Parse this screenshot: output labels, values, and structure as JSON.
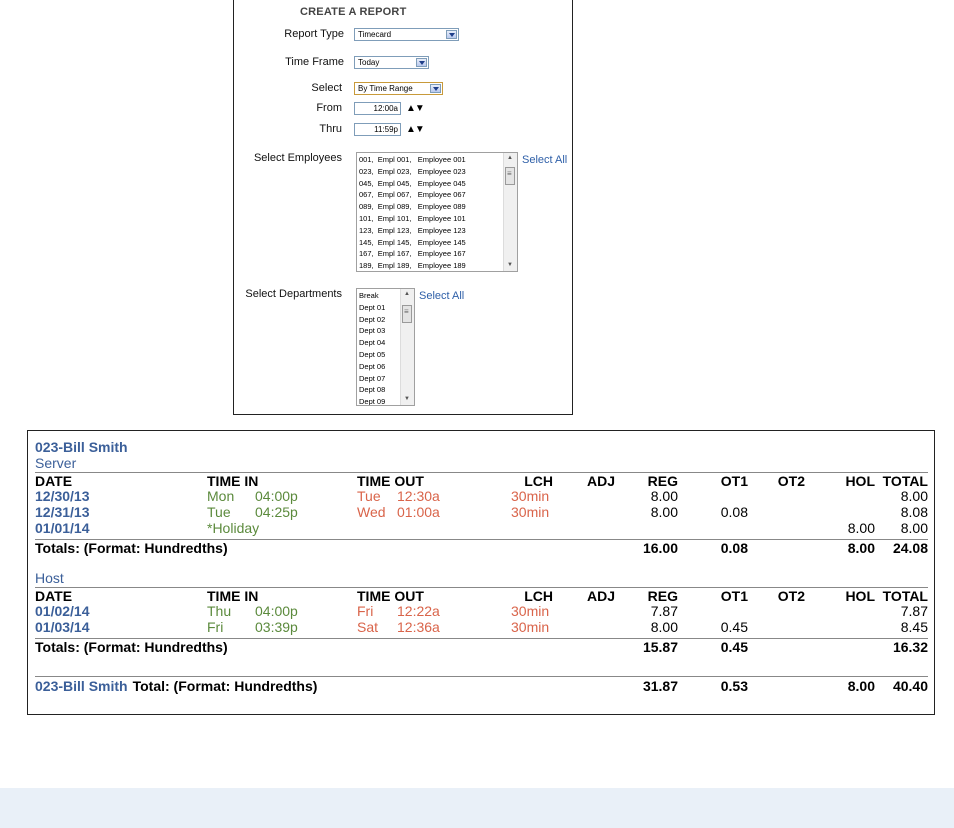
{
  "panel": {
    "title": "CREATE A REPORT",
    "report_type": {
      "label": "Report Type",
      "value": "Timecard"
    },
    "time_frame": {
      "label": "Time Frame",
      "value": "Today"
    },
    "select": {
      "label": "Select",
      "value": "By Time Range"
    },
    "from": {
      "label": "From",
      "value": "12:00a"
    },
    "thru": {
      "label": "Thru",
      "value": "11:59p"
    },
    "employees": {
      "label": "Select Employees",
      "select_all": "Select All",
      "items": [
        "001,  Empl 001,   Employee 001",
        "023,  Empl 023,   Employee 023",
        "045,  Empl 045,   Employee 045",
        "067,  Empl 067,   Employee 067",
        "089,  Empl 089,   Employee 089",
        "101,  Empl 101,   Employee 101",
        "123,  Empl 123,   Employee 123",
        "145,  Empl 145,   Employee 145",
        "167,  Empl 167,   Employee 167",
        "189,  Empl 189,   Employee 189"
      ]
    },
    "departments": {
      "label": "Select Departments",
      "select_all": "Select All",
      "items": [
        "Break",
        "Dept 01",
        "Dept 02",
        "Dept 03",
        "Dept 04",
        "Dept 05",
        "Dept 06",
        "Dept 07",
        "Dept 08",
        "Dept 09"
      ]
    }
  },
  "report": {
    "employee": "023-Bill Smith",
    "columns": [
      "DATE",
      "TIME IN",
      "TIME OUT",
      "LCH",
      "ADJ",
      "REG",
      "OT1",
      "OT2",
      "HOL",
      "TOTAL"
    ],
    "sections": [
      {
        "department": "Server",
        "rows": [
          {
            "date": "12/30/13",
            "in_day": "Mon",
            "in_time": "04:00p",
            "out_day": "Tue",
            "out_time": "12:30a",
            "lch": "30min",
            "adj": "",
            "reg": "8.00",
            "ot1": "",
            "ot2": "",
            "hol": "",
            "total": "8.00"
          },
          {
            "date": "12/31/13",
            "in_day": "Tue",
            "in_time": "04:25p",
            "out_day": "Wed",
            "out_time": "01:00a",
            "lch": "30min",
            "adj": "",
            "reg": "8.00",
            "ot1": "0.08",
            "ot2": "",
            "hol": "",
            "total": "8.08"
          },
          {
            "date": "01/01/14",
            "in_day": "*Holiday",
            "in_time": "",
            "out_day": "",
            "out_time": "",
            "lch": "",
            "adj": "",
            "reg": "",
            "ot1": "",
            "ot2": "",
            "hol": "8.00",
            "total": "8.00"
          }
        ],
        "totals": {
          "label": "Totals: (Format: Hundredths)",
          "reg": "16.00",
          "ot1": "0.08",
          "ot2": "",
          "hol": "8.00",
          "total": "24.08"
        }
      },
      {
        "department": "Host",
        "rows": [
          {
            "date": "01/02/14",
            "in_day": "Thu",
            "in_time": "04:00p",
            "out_day": "Fri",
            "out_time": "12:22a",
            "lch": "30min",
            "adj": "",
            "reg": "7.87",
            "ot1": "",
            "ot2": "",
            "hol": "",
            "total": "7.87"
          },
          {
            "date": "01/03/14",
            "in_day": "Fri",
            "in_time": "03:39p",
            "out_day": "Sat",
            "out_time": "12:36a",
            "lch": "30min",
            "adj": "",
            "reg": "8.00",
            "ot1": "0.45",
            "ot2": "",
            "hol": "",
            "total": "8.45"
          }
        ],
        "totals": {
          "label": "Totals: (Format: Hundredths)",
          "reg": "15.87",
          "ot1": "0.45",
          "ot2": "",
          "hol": "",
          "total": "16.32"
        }
      }
    ],
    "grand_total": {
      "employee": "023-Bill Smith",
      "label": "Total: (Format: Hundredths)",
      "reg": "31.87",
      "ot1": "0.53",
      "ot2": "",
      "hol": "8.00",
      "total": "40.40"
    }
  }
}
